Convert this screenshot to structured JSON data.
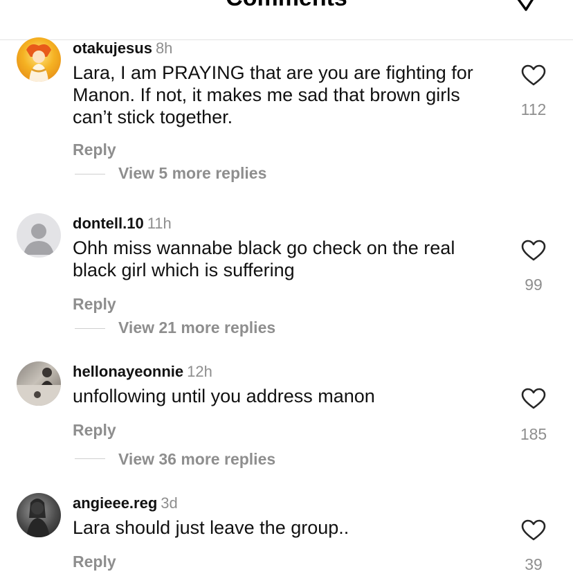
{
  "header": {
    "title": "Comments",
    "icon": "send-icon"
  },
  "colors": {
    "secondary_text": "#8e8e8e",
    "primary_text": "#111111",
    "divider": "#e3e3e3"
  },
  "comments": [
    {
      "username": "otakujesus",
      "time": "8h",
      "text": "Lara, I am PRAYING that are you are fighting for Manon. If not, it makes me sad that brown girls can’t stick together.",
      "reply_label": "Reply",
      "view_replies": "View 5 more replies",
      "likes": "112",
      "avatar_icon": "illustrated-avatar"
    },
    {
      "username": "dontell.10",
      "time": "11h",
      "text": "Ohh miss wannabe black go check on the real black girl which is suffering",
      "reply_label": "Reply",
      "view_replies": "View 21 more replies",
      "likes": "99",
      "avatar_icon": "default-profile-icon"
    },
    {
      "username": "hellonayeonnie",
      "time": "12h",
      "text": "unfollowing until you address manon",
      "reply_label": "Reply",
      "view_replies": "View 36 more replies",
      "likes": "185",
      "avatar_icon": "photo-avatar"
    },
    {
      "username": "angieee.reg",
      "time": "3d",
      "text": "Lara should just leave the group..",
      "reply_label": "Reply",
      "likes": "39",
      "avatar_icon": "photo-avatar"
    }
  ]
}
